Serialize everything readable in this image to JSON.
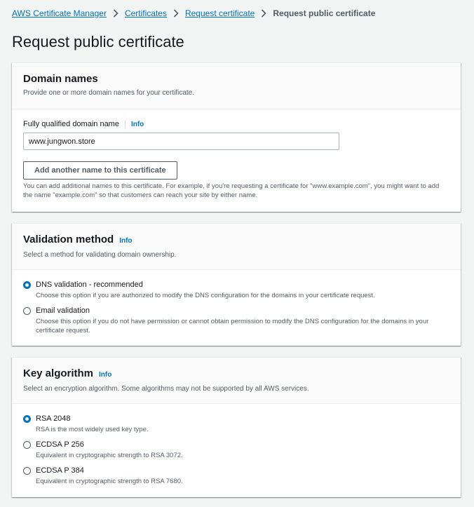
{
  "breadcrumb": {
    "items": [
      "AWS Certificate Manager",
      "Certificates",
      "Request certificate"
    ],
    "current": "Request public certificate"
  },
  "page": {
    "title": "Request public certificate"
  },
  "domain_names": {
    "title": "Domain names",
    "description": "Provide one or more domain names for your certificate.",
    "field_label": "Fully qualified domain name",
    "info_label": "Info",
    "field_value": "www.jungwon.store",
    "add_button": "Add another name to this certificate",
    "hint": "You can add additional names to this certificate. For example, if you're requesting a certificate for \"www.example.com\", you might want to add the name \"example.com\" so that customers can reach your site by either name."
  },
  "validation": {
    "title": "Validation method",
    "info_label": "Info",
    "description": "Select a method for validating domain ownership.",
    "options": [
      {
        "label": "DNS validation - recommended",
        "description": "Choose this option if you are authorized to modify the DNS configuration for the domains in your certificate request.",
        "selected": true
      },
      {
        "label": "Email validation",
        "description": "Choose this option if you do not have permission or cannot obtain permission to modify the DNS configuration for the domains in your certificate request.",
        "selected": false
      }
    ]
  },
  "key_algorithm": {
    "title": "Key algorithm",
    "info_label": "Info",
    "description": "Select an encryption algorithm. Some algorithms may not be supported by all AWS services.",
    "options": [
      {
        "label": "RSA 2048",
        "description": "RSA is the most widely used key type.",
        "selected": true
      },
      {
        "label": "ECDSA P 256",
        "description": "Equivalent in cryptographic strength to RSA 3072.",
        "selected": false
      },
      {
        "label": "ECDSA P 384",
        "description": "Equivalent in cryptographic strength to RSA 7680.",
        "selected": false
      }
    ]
  },
  "icons": {
    "breadcrumb_separator": "chevron-right-icon",
    "radio": "radio-button-icon"
  },
  "colors": {
    "link": "#0073bb",
    "page_bg": "#f2f3f3",
    "text": "#16191f",
    "muted": "#545b64"
  }
}
